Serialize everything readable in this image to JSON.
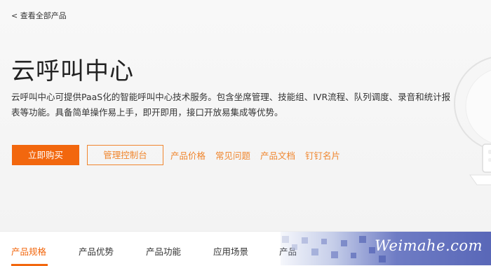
{
  "back_link": "< 查看全部产品",
  "title": "云呼叫中心",
  "description": "云呼叫中心可提供PaaS化的智能呼叫中心技术服务。包含坐席管理、技能组、IVR流程、队列调度、录音和统计报表等功能。具备简单操作易上手，即开即用，接口开放易集成等优势。",
  "actions": {
    "buy_label": "立即购买",
    "console_label": "管理控制台"
  },
  "links": [
    "产品价格",
    "常见问题",
    "产品文档",
    "钉钉名片"
  ],
  "tabs": [
    "产品规格",
    "产品优势",
    "产品功能",
    "应用场景",
    "产品"
  ],
  "active_tab": "产品规格",
  "watermark": "Weimahe.com",
  "colors": {
    "accent": "#f2670e",
    "accent_light": "#f0862e",
    "hero_bg": "#f6f6f6",
    "watermark_blue": "#5f6ebe"
  },
  "icons": {
    "device_illustration": "device-illustration-icon"
  }
}
